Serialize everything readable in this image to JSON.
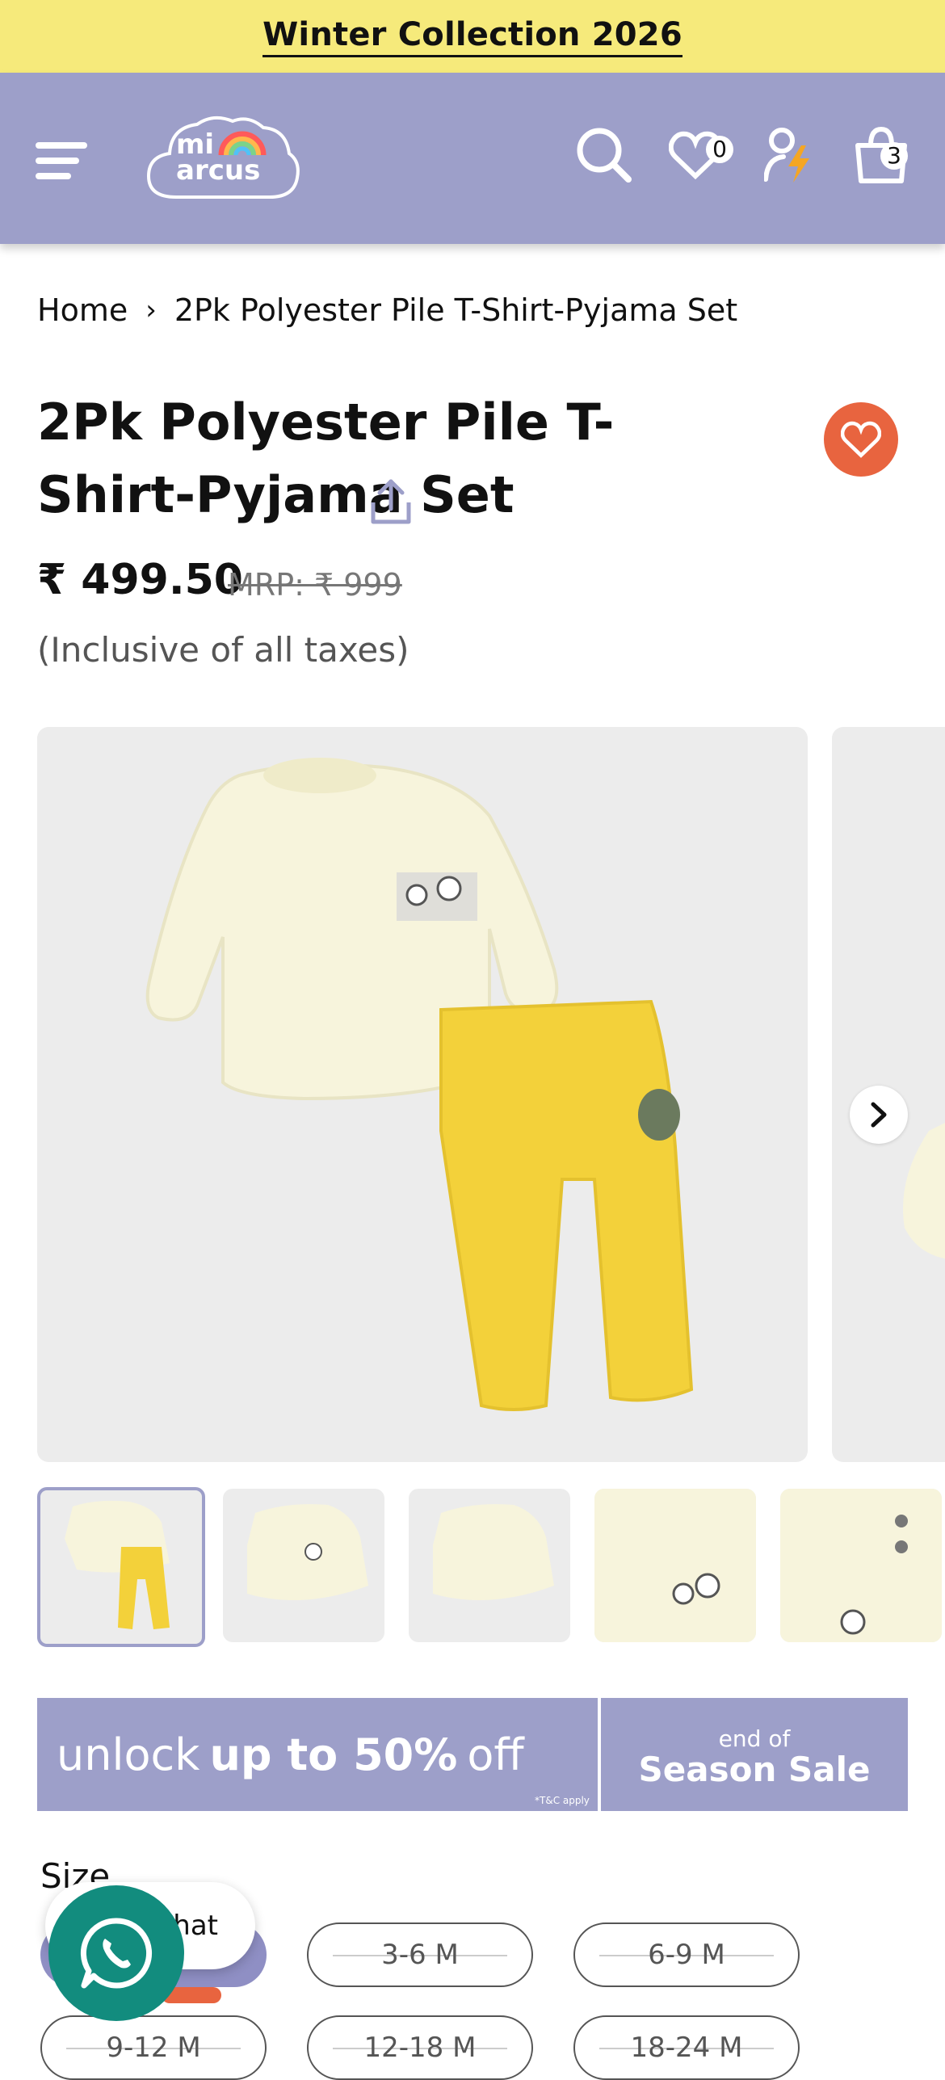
{
  "announcement": {
    "text": "Winter Collection 2026"
  },
  "header": {
    "logo_line1": "mi",
    "logo_line2": "arcus",
    "wishlist_count": "0",
    "cart_count": "3"
  },
  "breadcrumb": {
    "home": "Home",
    "current": "2Pk Polyester Pile T-Shirt-Pyjama Set"
  },
  "product": {
    "title": "2Pk Polyester Pile T-Shirt-Pyjama Set",
    "price": "₹ 499.50",
    "mrp": "MRP: ₹ 999",
    "tax_note": "(Inclusive of all taxes)"
  },
  "gallery": {
    "thumbnail_count": 5,
    "active_index": 0
  },
  "banner": {
    "unlock": "unlock",
    "discount": "up to 50%",
    "off": "off",
    "terms": "*T&C apply",
    "end_of": "end of",
    "season_sale": "Season Sale"
  },
  "size": {
    "label": "Size",
    "options": [
      "3-6 M",
      "6-9 M",
      "9-12 M",
      "12-18 M",
      "18-24 M"
    ]
  },
  "chat": {
    "label": "Chat"
  },
  "colors": {
    "announcement_bg": "#f6ea7b",
    "header_bg": "#9d9fc9",
    "favorite_bg": "#e8643f",
    "whatsapp": "#128c7e"
  }
}
